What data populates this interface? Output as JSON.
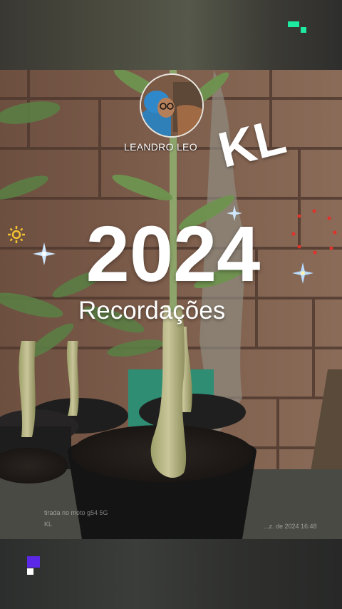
{
  "profile": {
    "name": "LEANDRO LEO"
  },
  "brand": {
    "text": "KL"
  },
  "title": {
    "year": "2024",
    "subtitle": "Recordações"
  },
  "watermark": {
    "device": "tirada no moto g54 5G",
    "tag": "KL",
    "timestamp": "...z. de 2024 16:48"
  },
  "icons": {
    "tv_logo": "tv-logo-icon",
    "sparkles": [
      "sparkle-icon"
    ],
    "sun": "sun-icon",
    "badge": "badge-icon",
    "moto": "motorola-logo-icon"
  },
  "colors": {
    "accent_green": "#1de9a0",
    "accent_violet": "#5a28e6",
    "sparkle_blue": "#a9d8ff"
  }
}
